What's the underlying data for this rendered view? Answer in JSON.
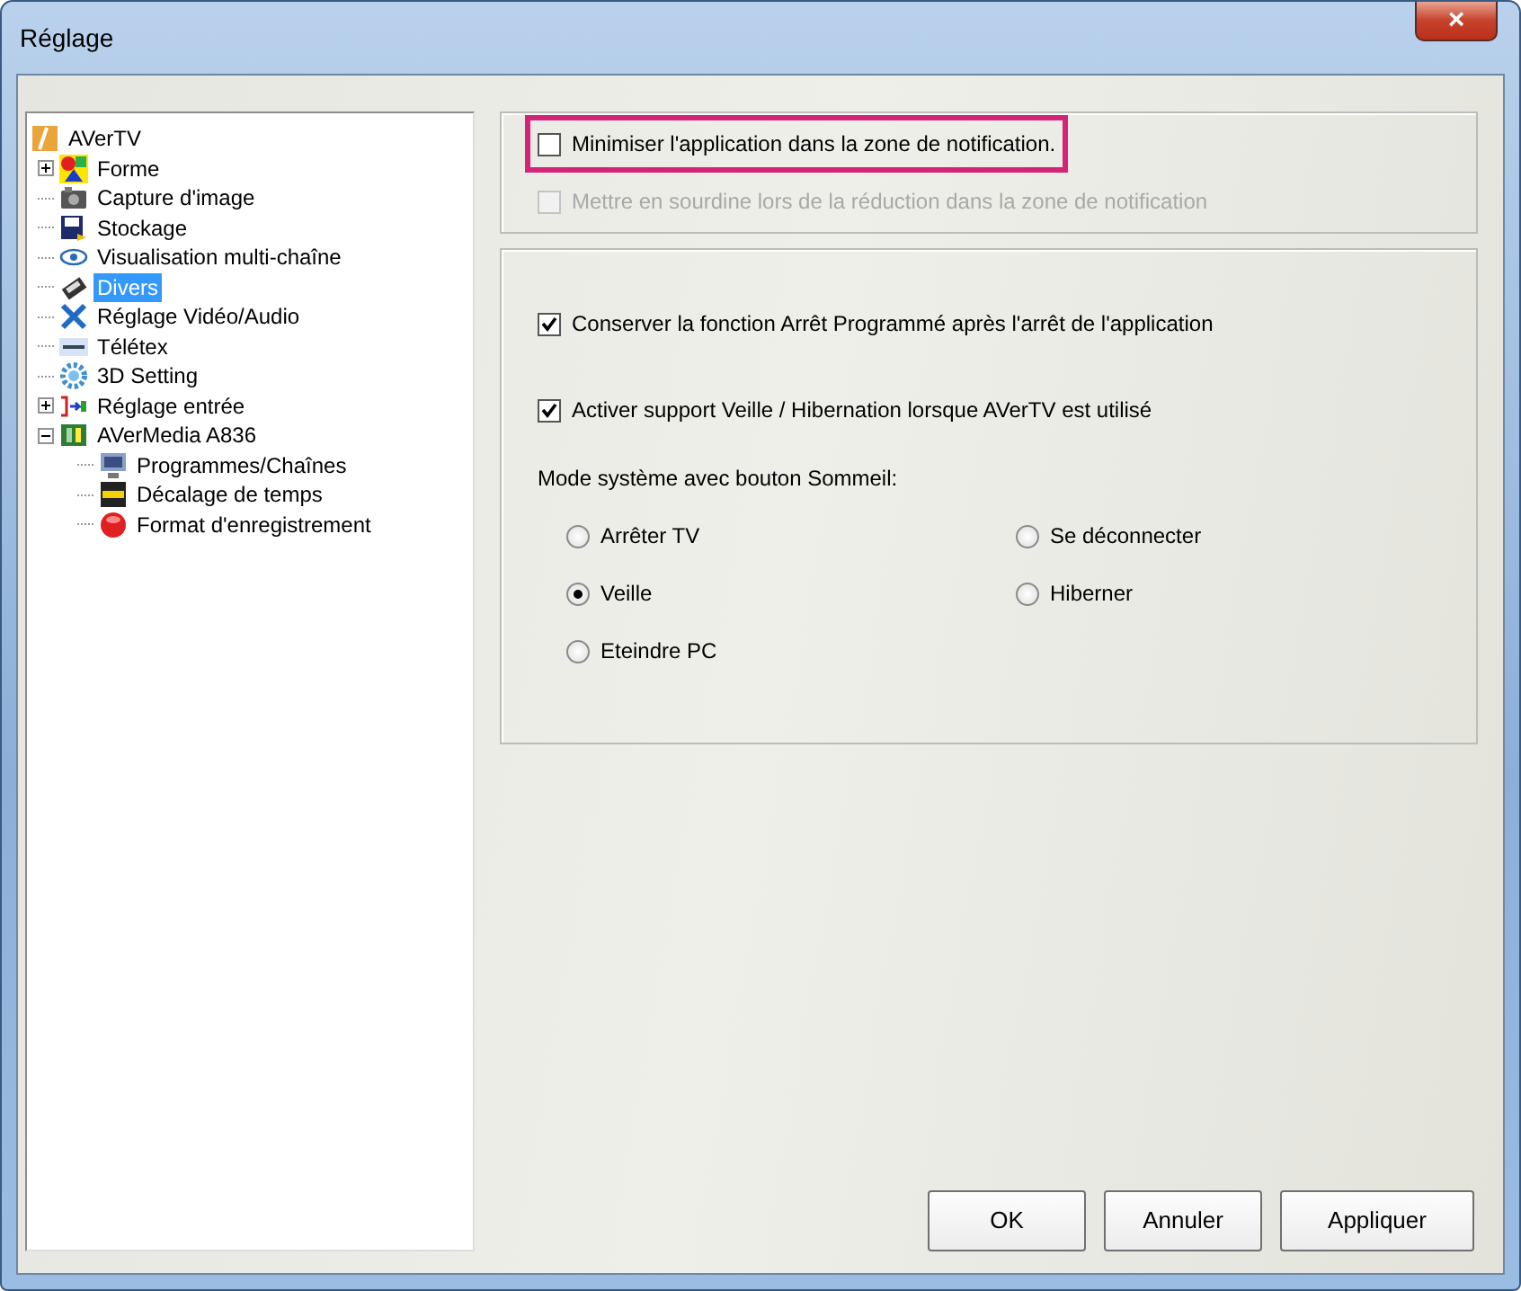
{
  "window": {
    "title": "Réglage",
    "close": "×"
  },
  "tree": {
    "label": "AVerTV",
    "children": [
      {
        "label": "Forme",
        "expanded": false,
        "selected": false
      },
      {
        "label": "Capture d'image",
        "selected": false
      },
      {
        "label": "Stockage",
        "selected": false
      },
      {
        "label": "Visualisation multi-chaîne",
        "selected": false
      },
      {
        "label": "Divers",
        "selected": true
      },
      {
        "label": "Réglage Vidéo/Audio",
        "selected": false
      },
      {
        "label": "Télétex",
        "selected": false
      },
      {
        "label": "3D Setting",
        "selected": false
      },
      {
        "label": "Réglage entrée",
        "expanded": false,
        "selected": false
      },
      {
        "label": "AVerMedia A836",
        "expanded": true,
        "selected": false,
        "children": [
          {
            "label": "Programmes/Chaînes",
            "selected": false
          },
          {
            "label": "Décalage de temps",
            "selected": false
          },
          {
            "label": "Format d'enregistrement",
            "selected": false
          }
        ]
      }
    ]
  },
  "notification_group": [
    {
      "label": "Minimiser l'application dans la zone de notification.",
      "checked": false,
      "disabled": false,
      "highlighted": true
    },
    {
      "label": "Mettre en sourdine lors de la réduction dans la zone de notification",
      "checked": false,
      "disabled": true
    }
  ],
  "options_group": {
    "checkboxes": [
      {
        "label": "Conserver la fonction Arrêt Programmé après l'arrêt de l'application",
        "checked": true
      },
      {
        "label": "Activer support Veille / Hibernation lorsque AVerTV est utilisé",
        "checked": true
      }
    ],
    "sleep_mode_label": "Mode système avec bouton Sommeil:",
    "radios": [
      {
        "label": "Arrêter TV",
        "selected": false
      },
      {
        "label": "Se déconnecter",
        "selected": false
      },
      {
        "label": "Veille",
        "selected": true
      },
      {
        "label": "Hiberner",
        "selected": false
      },
      {
        "label": "Eteindre PC",
        "selected": false
      }
    ]
  },
  "buttons": [
    "OK",
    "Annuler",
    "Appliquer"
  ]
}
